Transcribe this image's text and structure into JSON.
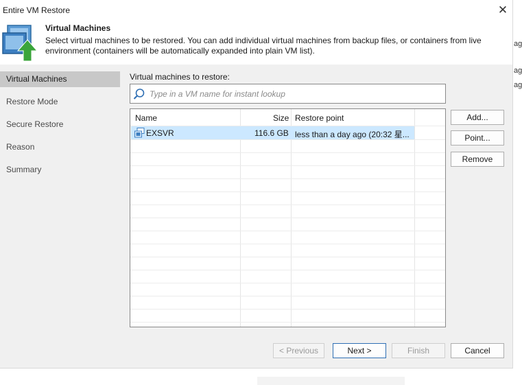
{
  "window": {
    "title": "Entire VM Restore"
  },
  "header": {
    "title": "Virtual Machines",
    "description": "Select virtual machines to be restored. You can add individual virtual machines from backup files, or containers from live environment (containers will be automatically expanded into plain VM list)."
  },
  "sidebar": {
    "items": [
      {
        "label": "Virtual Machines",
        "active": true
      },
      {
        "label": "Restore Mode",
        "active": false
      },
      {
        "label": "Secure Restore",
        "active": false
      },
      {
        "label": "Reason",
        "active": false
      },
      {
        "label": "Summary",
        "active": false
      }
    ]
  },
  "main": {
    "section_label": "Virtual machines to restore:",
    "search": {
      "placeholder": "Type in a VM name for instant lookup",
      "value": ""
    },
    "table": {
      "columns": [
        "Name",
        "Size",
        "Restore point"
      ],
      "rows": [
        {
          "name": "EXSVR",
          "size": "116.6 GB",
          "restore_point": "less than a day ago (20:32 星...",
          "selected": true
        }
      ]
    },
    "side_buttons": {
      "add": "Add...",
      "point": "Point...",
      "remove": "Remove"
    }
  },
  "footer": {
    "previous": "< Previous",
    "next": "Next >",
    "finish": "Finish",
    "cancel": "Cancel"
  },
  "background_fragments": [
    "ag",
    "ag",
    "ag"
  ],
  "colors": {
    "selection": "#cce8ff",
    "panel": "#f0f0f0",
    "active_nav": "#c8c8c8",
    "icon_blue": "#3d7fc1",
    "icon_green": "#3aa53a"
  },
  "icons": [
    "vm-restore-icon",
    "close-icon",
    "search-icon",
    "vm-icon"
  ]
}
